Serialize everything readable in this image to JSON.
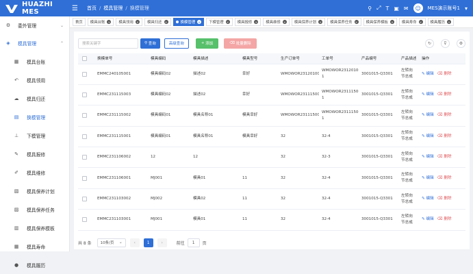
{
  "header": {
    "brand": "HUAZHI MES",
    "breadcrumb": [
      "首页",
      "模具管理",
      "换模管理"
    ],
    "user": "MES演示账号1",
    "icons": [
      "search-icon",
      "fullscreen-icon",
      "font-size-icon",
      "layout-icon",
      "message-icon"
    ]
  },
  "sidebar": {
    "items": [
      {
        "label": "委外管理",
        "icon": "outsourcing-icon",
        "type": "parent"
      },
      {
        "label": "模具管理",
        "icon": "mold-icon",
        "type": "parent-open"
      },
      {
        "label": "模具台账",
        "icon": "ledger-icon",
        "type": "sub"
      },
      {
        "label": "模具领用",
        "icon": "receive-icon",
        "type": "sub"
      },
      {
        "label": "模具归还",
        "icon": "return-icon",
        "type": "sub"
      },
      {
        "label": "换模管理",
        "icon": "change-mold-icon",
        "type": "active"
      },
      {
        "label": "下模管理",
        "icon": "unload-mold-icon",
        "type": "sub"
      },
      {
        "label": "模具报修",
        "icon": "report-repair-icon",
        "type": "sub"
      },
      {
        "label": "模具维修",
        "icon": "repair-icon",
        "type": "sub"
      },
      {
        "label": "模具保养计划",
        "icon": "plan-icon",
        "type": "sub"
      },
      {
        "label": "模具保养任务",
        "icon": "task-icon",
        "type": "sub"
      },
      {
        "label": "模具保养模板",
        "icon": "template-icon",
        "type": "sub"
      },
      {
        "label": "模具寿命",
        "icon": "life-icon",
        "type": "sub"
      },
      {
        "label": "模具履历",
        "icon": "history-icon",
        "type": "sub"
      }
    ]
  },
  "tabs": [
    "首页",
    "模具台账",
    "模具领用",
    "模具归还",
    "换模管理",
    "下模管理",
    "模具报修",
    "模具维修",
    "模具保养计划",
    "模具保养任务",
    "模具保养模板",
    "模具寿命",
    "模具履历"
  ],
  "active_tab": 4,
  "toolbar": {
    "search_placeholder": "搜索关键字",
    "query": "查询",
    "advanced": "高级查询",
    "add": "添加",
    "batch_delete": "批量删除"
  },
  "table": {
    "columns": [
      "换模单号",
      "模具编码",
      "模具描述",
      "模具型号",
      "生产订单号",
      "工单号",
      "产品编号",
      "产品描述",
      "操作"
    ],
    "rows": [
      [
        "EMMC240105001",
        "模具编码02",
        "描述02",
        "幸好",
        "WMOWOR231201001",
        "WMOWOR231201001-1",
        "3001015-Q3301",
        "左转向节总成"
      ],
      [
        "EMMC231115003",
        "模具编码02",
        "描述02",
        "幸好",
        "WMOWOR231115001",
        "WMOWOR231115001-1",
        "3001015-Q3301",
        "左转向节总成"
      ],
      [
        "EMMC231115002",
        "模具编码01",
        "模具名称01",
        "模具幸好",
        "WMOWOR231115001",
        "WMOWOR231115001-1",
        "3001015-Q3301",
        "左转向节总成"
      ],
      [
        "EMMC231115001",
        "模具编码01",
        "模具名称01",
        "模具幸好",
        "32",
        "32-4",
        "3001015-Q3301",
        "左转向节总成"
      ],
      [
        "EMMC231106002",
        "12",
        "12",
        "",
        "32",
        "32-3",
        "3001015-Q3301",
        "左转向节总成"
      ],
      [
        "EMMC231106001",
        "MJ001",
        "模具01",
        "11",
        "32",
        "32-4",
        "3001015-Q3301",
        "左转向节总成"
      ],
      [
        "EMMC231103002",
        "MJ002",
        "模具02",
        "11",
        "32",
        "32-4",
        "3001015-Q3301",
        "左转向节总成"
      ],
      [
        "EMMC231103001",
        "MJ001",
        "模具01",
        "11",
        "32",
        "32-4",
        "3001015-Q3301",
        "左转向节总成"
      ]
    ],
    "edit_label": "编辑",
    "delete_label": "删除"
  },
  "footer": {
    "total": "共 8 条",
    "page_size": "10条/页",
    "current_page": "1",
    "goto_label": "前往",
    "goto_value": "1",
    "page_suffix": "页"
  },
  "colors": {
    "primary": "#2f6fd6",
    "success": "#56c06a",
    "danger": "#e0575b"
  }
}
